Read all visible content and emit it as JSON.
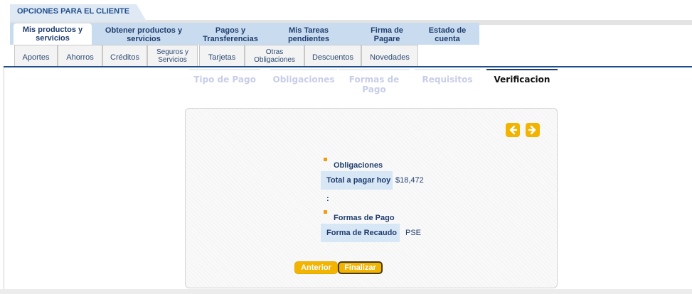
{
  "header": {
    "title": "OPCIONES PARA EL CLIENTE"
  },
  "main_nav": [
    {
      "label": "Mis productos y servicios",
      "active": true
    },
    {
      "label": "Obtener productos y servicios"
    },
    {
      "label": "Pagos y Transferencias"
    },
    {
      "label": "Mis Tareas pendientes"
    },
    {
      "label": "Firma de Pagare"
    },
    {
      "label": "Estado de cuenta"
    }
  ],
  "sub_nav": [
    {
      "label": "Aportes"
    },
    {
      "label": "Ahorros"
    },
    {
      "label": "Créditos"
    },
    {
      "label": "Seguros y Servicios"
    },
    {
      "label": "Tarjetas"
    },
    {
      "label": "Otras Obligaciones"
    },
    {
      "label": "Descuentos"
    },
    {
      "label": "Novedades"
    }
  ],
  "steps": [
    {
      "label": "Tipo de Pago"
    },
    {
      "label": "Obligaciones"
    },
    {
      "label": "Formas de Pago"
    },
    {
      "label": "Requisitos"
    },
    {
      "label": "Verificacion",
      "active": true
    }
  ],
  "obligaciones": {
    "title": "Obligaciones",
    "total_label": "Total a pagar hoy :",
    "total_value": "$18,472"
  },
  "formas_pago": {
    "title": "Formas de Pago",
    "label": "Forma de Recaudo",
    "value": "PSE"
  },
  "buttons": {
    "prev": "Anterior",
    "finish": "Finalizar"
  },
  "icons": {
    "prev_arrow": "arrow-left-icon",
    "next_arrow": "arrow-right-icon"
  },
  "colors": {
    "brand_blue": "#1f4e8c",
    "nav_bg": "#c9dcef",
    "accent_yellow": "#f2b400",
    "marker_orange": "#f39c12"
  }
}
